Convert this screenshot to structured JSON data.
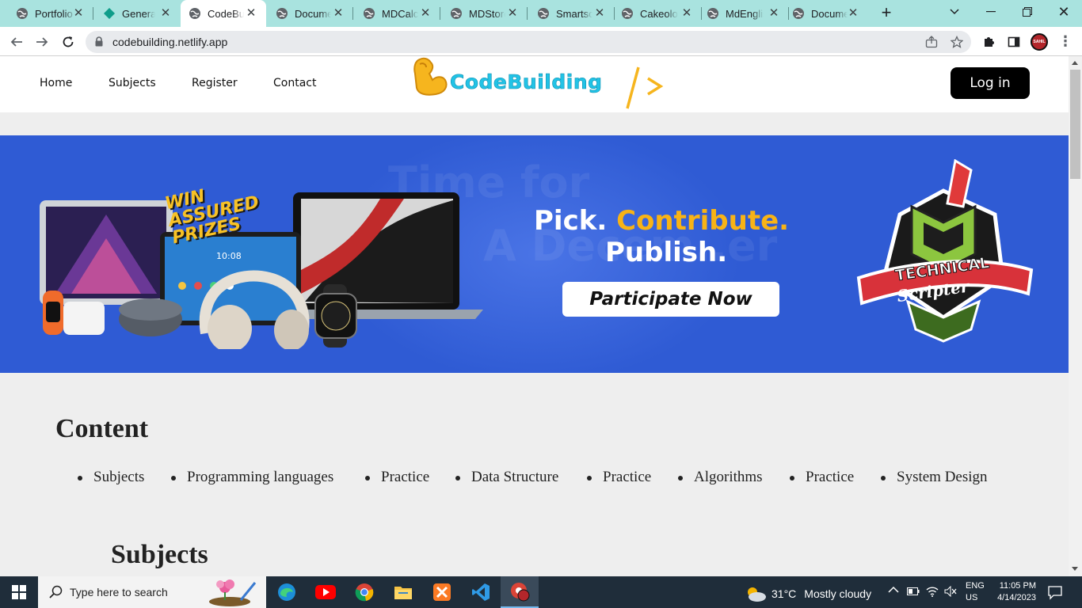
{
  "browser": {
    "tabs": [
      {
        "label": "Portfolio",
        "icon": "globe-icon",
        "active": false
      },
      {
        "label": "General",
        "icon": "diamond-icon",
        "active": false
      },
      {
        "label": "CodeBuilding",
        "icon": "globe-icon",
        "active": true
      },
      {
        "label": "Document",
        "icon": "globe-icon",
        "active": false
      },
      {
        "label": "MDCalcy",
        "icon": "globe-icon",
        "active": false
      },
      {
        "label": "MDStore",
        "icon": "globe-icon",
        "active": false
      },
      {
        "label": "Smartscale",
        "icon": "globe-icon",
        "active": false
      },
      {
        "label": "Cakeology",
        "icon": "globe-icon",
        "active": false
      },
      {
        "label": "MdEnglish",
        "icon": "globe-icon",
        "active": false
      },
      {
        "label": "Document",
        "icon": "globe-icon",
        "active": false
      }
    ],
    "url": "codebuilding.netlify.app",
    "profile_text": "SAHIL"
  },
  "site": {
    "nav": [
      "Home",
      "Subjects",
      "Register",
      "Contact"
    ],
    "logo_text": "CodeBuilding",
    "logo_suffix": "/ >",
    "login_label": "Log in"
  },
  "banner": {
    "badge_line1": "WIN",
    "badge_line2": "ASSURED",
    "badge_line3": "PRIZES",
    "headline_part1": "Pick.",
    "headline_part2": "Contribute.",
    "headline_line2": "Publish.",
    "cta_label": "Participate Now",
    "brand_text": "TECHNICAL",
    "brand_subtext": "Scripter",
    "tablet_time": "10:08",
    "accent_color": "#f8b316",
    "background_color": "#2f5bd4"
  },
  "content": {
    "title": "Content",
    "items": [
      "Subjects",
      "Programming languages",
      "Practice",
      "Data Structure",
      "Practice",
      "Algorithms",
      "Practice",
      "System Design"
    ]
  },
  "subjects": {
    "title": "Subjects"
  },
  "taskbar": {
    "search_placeholder": "Type here to search",
    "weather_temp": "31°C",
    "weather_desc": "Mostly cloudy",
    "lang_line1": "ENG",
    "lang_line2": "US",
    "time": "11:05 PM",
    "date": "4/14/2023"
  }
}
